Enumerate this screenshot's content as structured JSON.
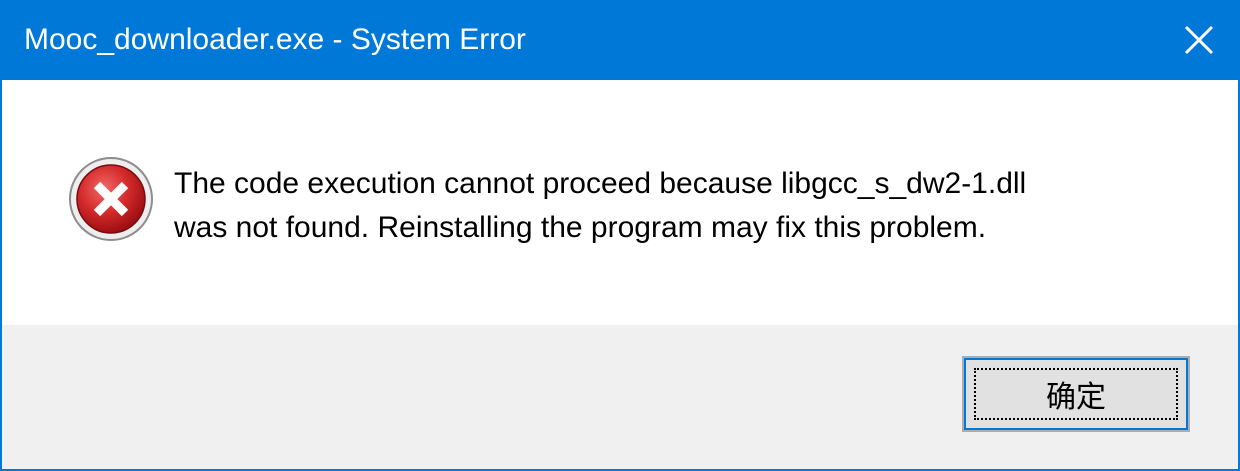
{
  "window": {
    "title": "Mooc_downloader.exe - System Error",
    "close_icon": "close-icon"
  },
  "message": {
    "icon": "error-icon",
    "line1": "The code execution cannot proceed because libgcc_s_dw2-1.dll",
    "line2": "was not found. Reinstalling the program may fix this problem."
  },
  "buttons": {
    "ok_label": "确定"
  },
  "colors": {
    "titlebar": "#0078d7",
    "footer": "#f0f0f0",
    "error_red": "#c4161c"
  }
}
